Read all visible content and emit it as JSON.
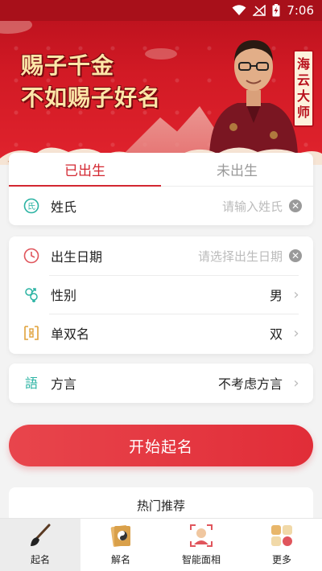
{
  "status_bar": {
    "time": "7:06"
  },
  "banner": {
    "slogan_line1": "赐子千金",
    "slogan_line2": "不如赐子好名",
    "master_name": "海云大师",
    "colors": {
      "bg": "#d21a25",
      "slogan": "#fde6a8"
    }
  },
  "tabs": [
    {
      "label": "已出生",
      "active": true
    },
    {
      "label": "未出生",
      "active": false
    }
  ],
  "form": {
    "surname": {
      "label": "姓氏",
      "placeholder": "请输入姓氏",
      "icon": "surname-icon"
    },
    "birth_date": {
      "label": "出生日期",
      "placeholder": "请选择出生日期",
      "icon": "clock-icon"
    },
    "gender": {
      "label": "性别",
      "value": "男",
      "icon": "gender-icon"
    },
    "name_length": {
      "label": "单双名",
      "value": "双",
      "icon": "name-length-icon"
    },
    "dialect": {
      "label": "方言",
      "value": "不考虑方言",
      "icon": "dialect-icon"
    }
  },
  "start_button": {
    "label": "开始起名"
  },
  "hot": {
    "title": "热门推荐"
  },
  "nav": [
    {
      "label": "起名",
      "icon": "brush-icon",
      "active": true
    },
    {
      "label": "解名",
      "icon": "taiji-icon",
      "active": false
    },
    {
      "label": "智能面相",
      "icon": "face-scan-icon",
      "active": false
    },
    {
      "label": "更多",
      "icon": "more-grid-icon",
      "active": false
    }
  ],
  "accent_color": "#d32731"
}
